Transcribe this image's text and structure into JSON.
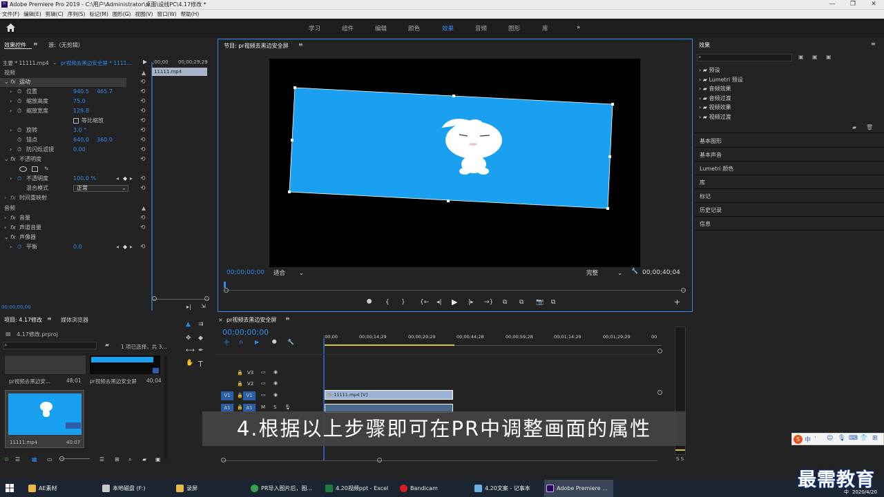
{
  "window": {
    "title": "Adobe Premiere Pro 2019 - C:\\用户\\Administrator\\桌面\\设线PC\\4.17修改 *",
    "pr_icon": "Pr"
  },
  "menu": [
    "文件(F)",
    "编辑(E)",
    "剪辑(C)",
    "序列(S)",
    "标记(M)",
    "图形(G)",
    "视图(V)",
    "窗口(W)",
    "帮助(H)"
  ],
  "workspaces": [
    {
      "label": "学习",
      "active": false
    },
    {
      "label": "组件",
      "active": false
    },
    {
      "label": "编辑",
      "active": false
    },
    {
      "label": "颜色",
      "active": false
    },
    {
      "label": "效果",
      "active": true
    },
    {
      "label": "音频",
      "active": false
    },
    {
      "label": "图形",
      "active": false
    },
    {
      "label": "库",
      "active": false
    }
  ],
  "effect_controls": {
    "tab": "效果控件",
    "tab2": "源:（无剪辑）",
    "master": "主要 * 11111.mp4",
    "clip": "pr视频去黑边安全屏 * 1111...",
    "time_start": ";00;00",
    "time_end": "00;00;29;29",
    "clip_label": "11111.mp4",
    "video_header": "视频",
    "motion": "运动",
    "opacity_section": "不透明度",
    "time_remap": "时间重映射",
    "audio_header": "音频",
    "volume": "音量",
    "channel_volume": "声道音量",
    "panner": "声像器",
    "props": [
      {
        "label": "位置",
        "v1": "940.5",
        "v2": "465.7"
      },
      {
        "label": "缩放高度",
        "v1": "75.0",
        "v2": ""
      },
      {
        "label": "缩放宽度",
        "v1": "128.8",
        "v2": ""
      },
      {
        "label": "等比缩放",
        "v1": "",
        "v2": ""
      },
      {
        "label": "旋转",
        "v1": "3.0 °",
        "v2": ""
      },
      {
        "label": "锚点",
        "v1": "640.0",
        "v2": "360.0"
      },
      {
        "label": "防闪烁滤镜",
        "v1": "0.00",
        "v2": ""
      }
    ],
    "opacity": {
      "label": "不透明度",
      "value": "100.0 %"
    },
    "blend": {
      "label": "混合模式",
      "value": "正常"
    },
    "balance": {
      "label": "平衡",
      "value": "0.0"
    },
    "bottom_time": "00;00;00;00"
  },
  "program": {
    "title": "节目: pr视频去黑边安全屏",
    "timecode": "00;00;00;00",
    "fit": "适合",
    "quality": "完整",
    "duration": "00;00;40;04",
    "frame_color": "#1aa0f0"
  },
  "project": {
    "tab": "项目: 4.17修改",
    "tab2": "媒体浏览器",
    "file": "4.17修改.prproj",
    "selection": "1 项已选择，共 3...",
    "items": [
      {
        "name": "pr视频去黑边安...",
        "dur": "48;01"
      },
      {
        "name": "pr视频去黑边安全屏",
        "dur": "40;04"
      },
      {
        "name": "11111.mp4",
        "dur": "40:07"
      }
    ]
  },
  "timeline": {
    "title": "pr视频去黑边安全屏",
    "timecode": "00;00;00;00",
    "ruler": [
      ";00;00",
      "00;00;14;29",
      "00;00;29;29",
      "00;00;44;28",
      "00;00;59;28",
      "00;01;14;29",
      "00;01;29;29",
      "00"
    ],
    "tracks": [
      "V3",
      "V2",
      "V1",
      "A1"
    ],
    "clip": "11111.mp4 [V]"
  },
  "effects": {
    "title": "效果",
    "folders": [
      "预设",
      "Lumetri 预设",
      "音频效果",
      "音频过渡",
      "视频效果",
      "视频过渡"
    ],
    "panels": [
      "基本图形",
      "基本声音",
      "Lumetri 颜色",
      "库",
      "标记",
      "历史记录",
      "信息"
    ]
  },
  "caption": "4.根据以上步骤即可在PR中调整画面的属性",
  "taskbar": [
    {
      "label": "AE素材",
      "color": "#e8b84a"
    },
    {
      "label": "本地磁盘 (F:)",
      "color": "#c8c8c8"
    },
    {
      "label": "录屏",
      "color": "#e8b84a"
    },
    {
      "label": "PR导入图片后，图...",
      "color": "#3aa04a"
    },
    {
      "label": "4.20视频ppt - Excel",
      "color": "#1d7a3e"
    },
    {
      "label": "Bandicam",
      "color": "#d62020"
    },
    {
      "label": "4.20文案 - 记事本",
      "color": "#6ab0e0"
    },
    {
      "label": "Adobe Premiere ...",
      "color": "#2a0a5e"
    }
  ],
  "tray": {
    "ime": "中",
    "date": "2020/4/20"
  },
  "watermark": "最需教育"
}
